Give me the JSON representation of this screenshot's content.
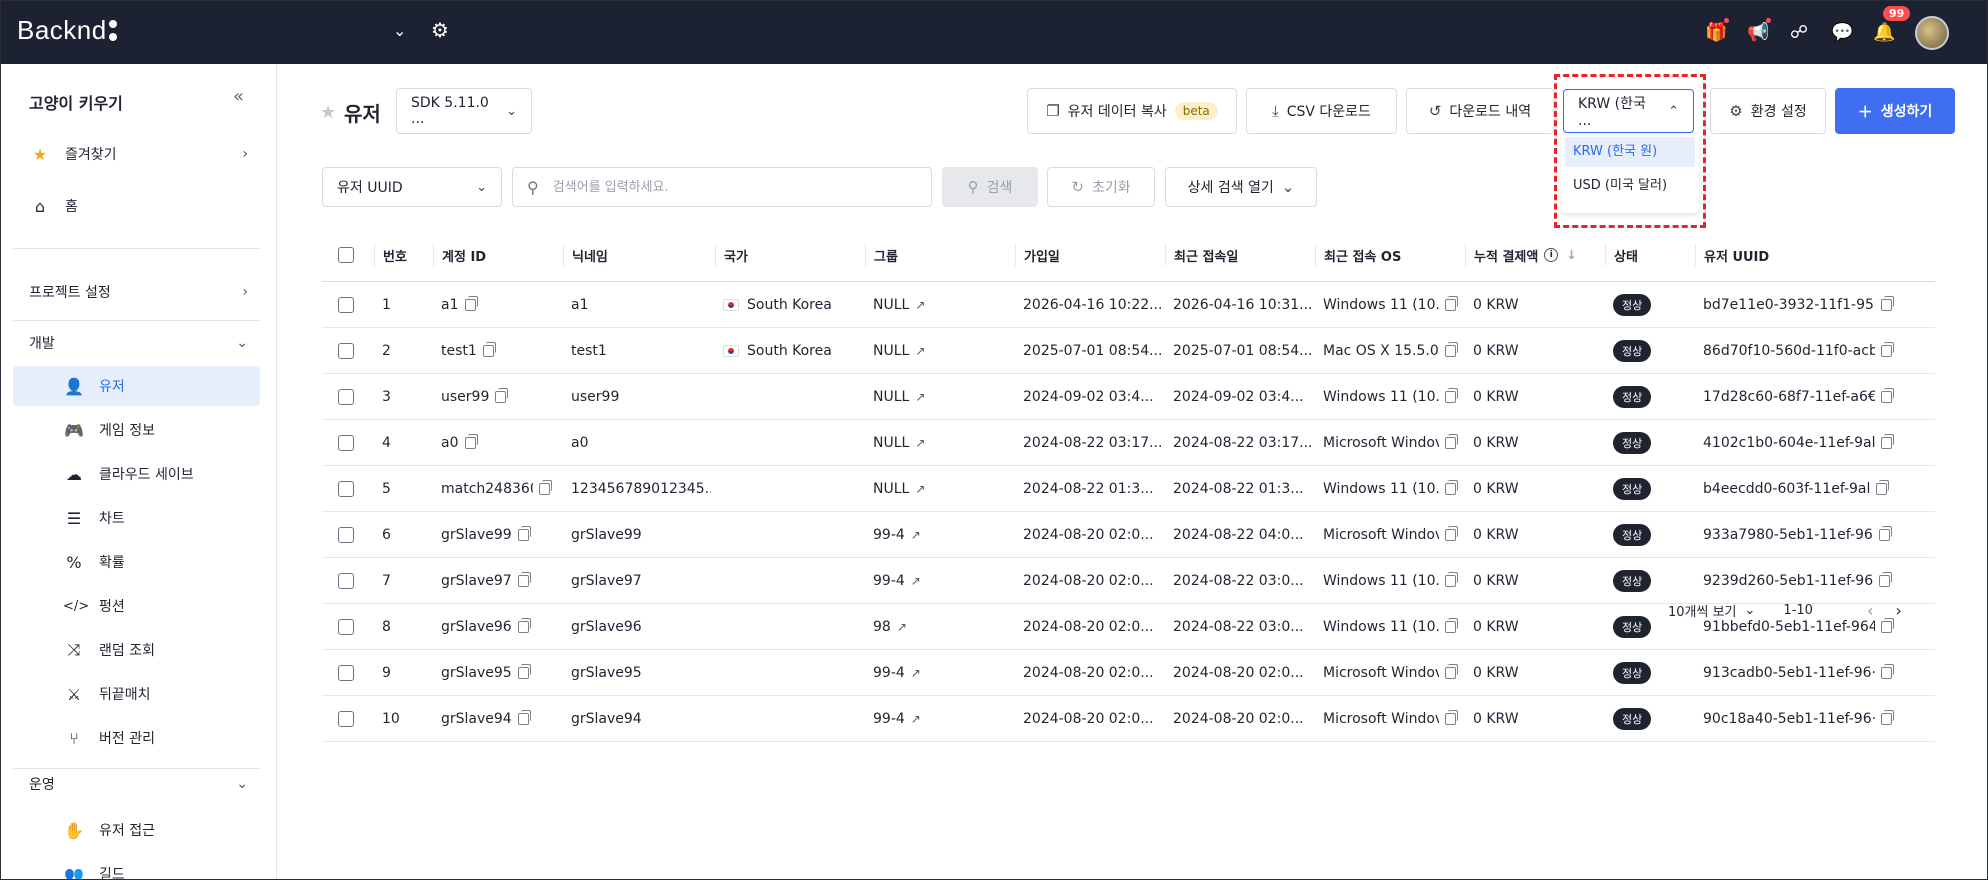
{
  "topbar": {
    "logo": "Backnd",
    "notification_count": "99"
  },
  "sidebar": {
    "project": "고양이 키우기",
    "favorites": "즐겨찾기",
    "home": "홈",
    "project_settings": "프로젝트 설정",
    "dev_section": "개발",
    "dev_items": [
      "유저",
      "게임 정보",
      "클라우드 세이브",
      "차트",
      "확률",
      "펑션",
      "랜덤 조회",
      "뒤끝매치",
      "버전 관리"
    ],
    "ops_section": "운영",
    "ops_items": [
      "유저 접근",
      "길드"
    ]
  },
  "header": {
    "title": "유저",
    "sdk_select": "SDK 5.11.0 ...",
    "copy_user_data": "유저 데이터 복사",
    "beta": "beta",
    "csv_download": "CSV 다운로드",
    "download_history": "다운로드 내역",
    "currency_select": "KRW (한국 ...",
    "settings": "환경 설정",
    "create": "생성하기"
  },
  "currency_options": [
    "KRW (한국 원)",
    "USD (미국 달러)"
  ],
  "search": {
    "field_select": "유저 UUID",
    "placeholder": "검색어를 입력하세요.",
    "search_button": "검색",
    "reset_button": "초기화",
    "advanced_button": "상세 검색 열기"
  },
  "table": {
    "columns": [
      "번호",
      "계정 ID",
      "닉네임",
      "국가",
      "그룹",
      "가입일",
      "최근 접속일",
      "최근 접속 OS",
      "누적 결제액",
      "상태",
      "유저 UUID"
    ],
    "rows": [
      {
        "no": "1",
        "account": "a1",
        "nick": "a1",
        "country": "South Korea",
        "group": "NULL",
        "joined": "2026-04-16 10:22...",
        "last": "2026-04-16 10:31...",
        "os": "Windows 11 (10.0",
        "paid": "0 KRW",
        "status": "정상",
        "uuid": "bd7e11e0-3932-11f1-956"
      },
      {
        "no": "2",
        "account": "test1",
        "nick": "test1",
        "country": "South Korea",
        "group": "NULL",
        "joined": "2025-07-01 08:54...",
        "last": "2025-07-01 08:54...",
        "os": "Mac OS X 15.5.0",
        "paid": "0 KRW",
        "status": "정상",
        "uuid": "86d70f10-560d-11f0-acb"
      },
      {
        "no": "3",
        "account": "user99",
        "nick": "user99",
        "country": "",
        "group": "NULL",
        "joined": "2024-09-02 03:4...",
        "last": "2024-09-02 03:4...",
        "os": "Windows 11 (10.0",
        "paid": "0 KRW",
        "status": "정상",
        "uuid": "17d28c60-68f7-11ef-a6€"
      },
      {
        "no": "4",
        "account": "a0",
        "nick": "a0",
        "country": "",
        "group": "NULL",
        "joined": "2024-08-22 03:17...",
        "last": "2024-08-22 03:17...",
        "os": "Microsoft Windov",
        "paid": "0 KRW",
        "status": "정상",
        "uuid": "4102c1b0-604e-11ef-9al"
      },
      {
        "no": "5",
        "account": "match248360",
        "nick": "123456789012345...",
        "country": "",
        "group": "NULL",
        "joined": "2024-08-22 01:3...",
        "last": "2024-08-22 01:3...",
        "os": "Windows 11 (10.0",
        "paid": "0 KRW",
        "status": "정상",
        "uuid": "b4eecdd0-603f-11ef-9al"
      },
      {
        "no": "6",
        "account": "grSlave99",
        "nick": "grSlave99",
        "country": "",
        "group": "99-4",
        "joined": "2024-08-20 02:0...",
        "last": "2024-08-22 04:0...",
        "os": "Microsoft Windov",
        "paid": "0 KRW",
        "status": "정상",
        "uuid": "933a7980-5eb1-11ef-96"
      },
      {
        "no": "7",
        "account": "grSlave97",
        "nick": "grSlave97",
        "country": "",
        "group": "99-4",
        "joined": "2024-08-20 02:0...",
        "last": "2024-08-22 03:0...",
        "os": "Windows 11 (10.0",
        "paid": "0 KRW",
        "status": "정상",
        "uuid": "9239d260-5eb1-11ef-96"
      },
      {
        "no": "8",
        "account": "grSlave96",
        "nick": "grSlave96",
        "country": "",
        "group": "98",
        "joined": "2024-08-20 02:0...",
        "last": "2024-08-22 03:0...",
        "os": "Windows 11 (10.0",
        "paid": "0 KRW",
        "status": "정상",
        "uuid": "91bbefd0-5eb1-11ef-964"
      },
      {
        "no": "9",
        "account": "grSlave95",
        "nick": "grSlave95",
        "country": "",
        "group": "99-4",
        "joined": "2024-08-20 02:0...",
        "last": "2024-08-20 02:0...",
        "os": "Microsoft Windov",
        "paid": "0 KRW",
        "status": "정상",
        "uuid": "913cadb0-5eb1-11ef-96·"
      },
      {
        "no": "10",
        "account": "grSlave94",
        "nick": "grSlave94",
        "country": "",
        "group": "99-4",
        "joined": "2024-08-20 02:0...",
        "last": "2024-08-20 02:0...",
        "os": "Microsoft Windov",
        "paid": "0 KRW",
        "status": "정상",
        "uuid": "90c18a40-5eb1-11ef-96·"
      }
    ]
  },
  "pagination": {
    "per_page": "10개씩 보기",
    "range": "1-10"
  }
}
